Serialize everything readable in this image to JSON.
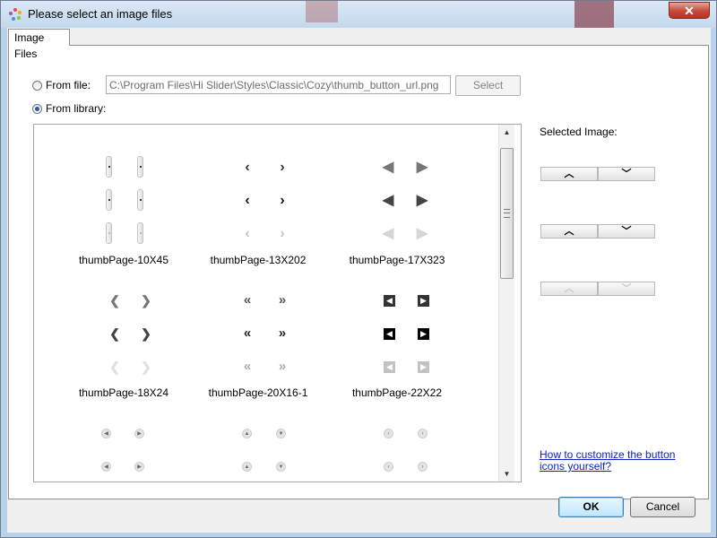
{
  "window": {
    "title": "Please select an image files",
    "close_glyph": "✕"
  },
  "tab": {
    "label": "Image Files"
  },
  "from_file": {
    "label": "From file:",
    "selected": false,
    "path_value": "C:\\Program Files\\Hi Slider\\Styles\\Classic\\Cozy\\thumb_button_url.png",
    "select_label": "Select"
  },
  "from_library": {
    "label": "From library:",
    "selected": true
  },
  "library": {
    "items": [
      {
        "label": "thumbPage-10X45",
        "style": "vbar"
      },
      {
        "label": "thumbPage-13X202",
        "style": "chevron"
      },
      {
        "label": "thumbPage-17X323",
        "style": "triangle"
      },
      {
        "label": "thumbPage-18X24",
        "style": "bold-chevron"
      },
      {
        "label": "thumbPage-20X16-1",
        "style": "double-chevron"
      },
      {
        "label": "thumbPage-22X22",
        "style": "square"
      },
      {
        "label": "",
        "style": "circle-lr"
      },
      {
        "label": "",
        "style": "circle-ud"
      },
      {
        "label": "",
        "style": "circle-lr2"
      }
    ]
  },
  "scrollbar": {
    "up_glyph": "▲",
    "down_glyph": "▼"
  },
  "selected_image": {
    "label": "Selected Image:",
    "up_glyph": "︿",
    "down_glyph": "﹀"
  },
  "help_link": {
    "text": "How to customize the button icons yourself?"
  },
  "buttons": {
    "ok": "OK",
    "cancel": "Cancel"
  },
  "colors": {
    "link": "#0b22c8",
    "title_bg": "#c3d7ec",
    "close_bg": "#c7473a"
  }
}
